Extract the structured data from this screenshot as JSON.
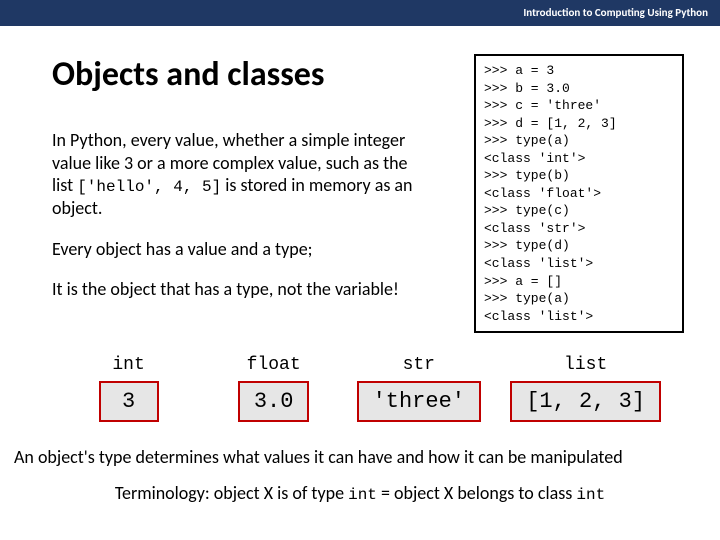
{
  "header": "Introduction to Computing Using Python",
  "title": "Objects and classes",
  "para1_a": "In Python, every value, whether a simple integer value like 3 or a more complex value, such as the list ",
  "para1_code": "['hello', 4,  5]",
  "para1_b": " is stored in memory as an object.",
  "para2": "Every object has a value and a type;",
  "para3": "It is the object that has a type, not the variable!",
  "code": ">>> a = 3\n>>> b = 3.0\n>>> c = 'three'\n>>> d = [1, 2, 3]\n>>> type(a)\n<class 'int'>\n>>> type(b)\n<class 'float'>\n>>> type(c)\n<class 'str'>\n>>> type(d)\n<class 'list'>\n>>> a = []\n>>> type(a)\n<class 'list'>",
  "types": [
    {
      "label": "int",
      "value": "3"
    },
    {
      "label": "float",
      "value": "3.0"
    },
    {
      "label": "str",
      "value": "'three'"
    },
    {
      "label": "list",
      "value": "[1, 2, 3]"
    }
  ],
  "footer1": "An object's type determines what values it can have and how it can be manipulated",
  "footer2_a": "Terminology: object X is of type ",
  "footer2_code1": "int",
  "footer2_b": " = object X belongs to class ",
  "footer2_code2": "int"
}
